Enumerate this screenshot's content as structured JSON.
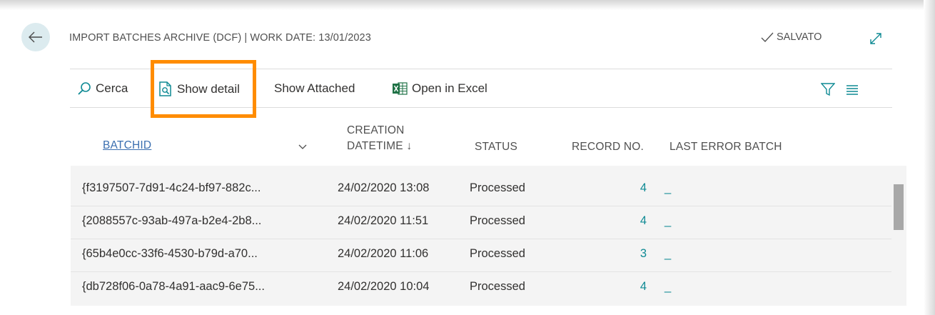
{
  "header": {
    "title": "IMPORT BATCHES ARCHIVE (DCF) | WORK DATE: 13/01/2023",
    "saved_label": "SALVATO"
  },
  "toolbar": {
    "search_label": "Cerca",
    "show_detail_label": "Show detail",
    "show_attached_label": "Show Attached",
    "open_excel_label": "Open in Excel"
  },
  "table": {
    "columns": {
      "batchid": "BATCHID",
      "creation_line1": "CREATION",
      "creation_line2": "DATETIME ↓",
      "status": "STATUS",
      "record_no": "RECORD NO.",
      "last_error": "LAST ERROR BATCH"
    },
    "rows": [
      {
        "batchid": "{f3197507-7d91-4c24-bf97-882c...",
        "datetime": "24/02/2020 13:08",
        "status": "Processed",
        "record_no": "4",
        "last_error": "_"
      },
      {
        "batchid": "{2088557c-93ab-497a-b2e4-2b8...",
        "datetime": "24/02/2020 11:51",
        "status": "Processed",
        "record_no": "4",
        "last_error": "_"
      },
      {
        "batchid": "{65b4e0cc-33f6-4530-b79d-a70...",
        "datetime": "24/02/2020 11:06",
        "status": "Processed",
        "record_no": "3",
        "last_error": "_"
      },
      {
        "batchid": "{db728f06-0a78-4a91-aac9-6e75...",
        "datetime": "24/02/2020 10:04",
        "status": "Processed",
        "record_no": "4",
        "last_error": "_"
      }
    ]
  },
  "colors": {
    "accent": "#0f8a94",
    "highlight": "#ff8c00",
    "back_button_bg": "#dcebef",
    "excel_green": "#1e7145"
  },
  "icons": {
    "back": "arrow-left-icon",
    "saved": "check-icon",
    "expand": "expand-icon",
    "search": "search-icon",
    "show_detail": "document-search-icon",
    "excel": "excel-icon",
    "filter": "filter-icon",
    "list": "list-icon",
    "sort": "chevron-down-icon"
  }
}
